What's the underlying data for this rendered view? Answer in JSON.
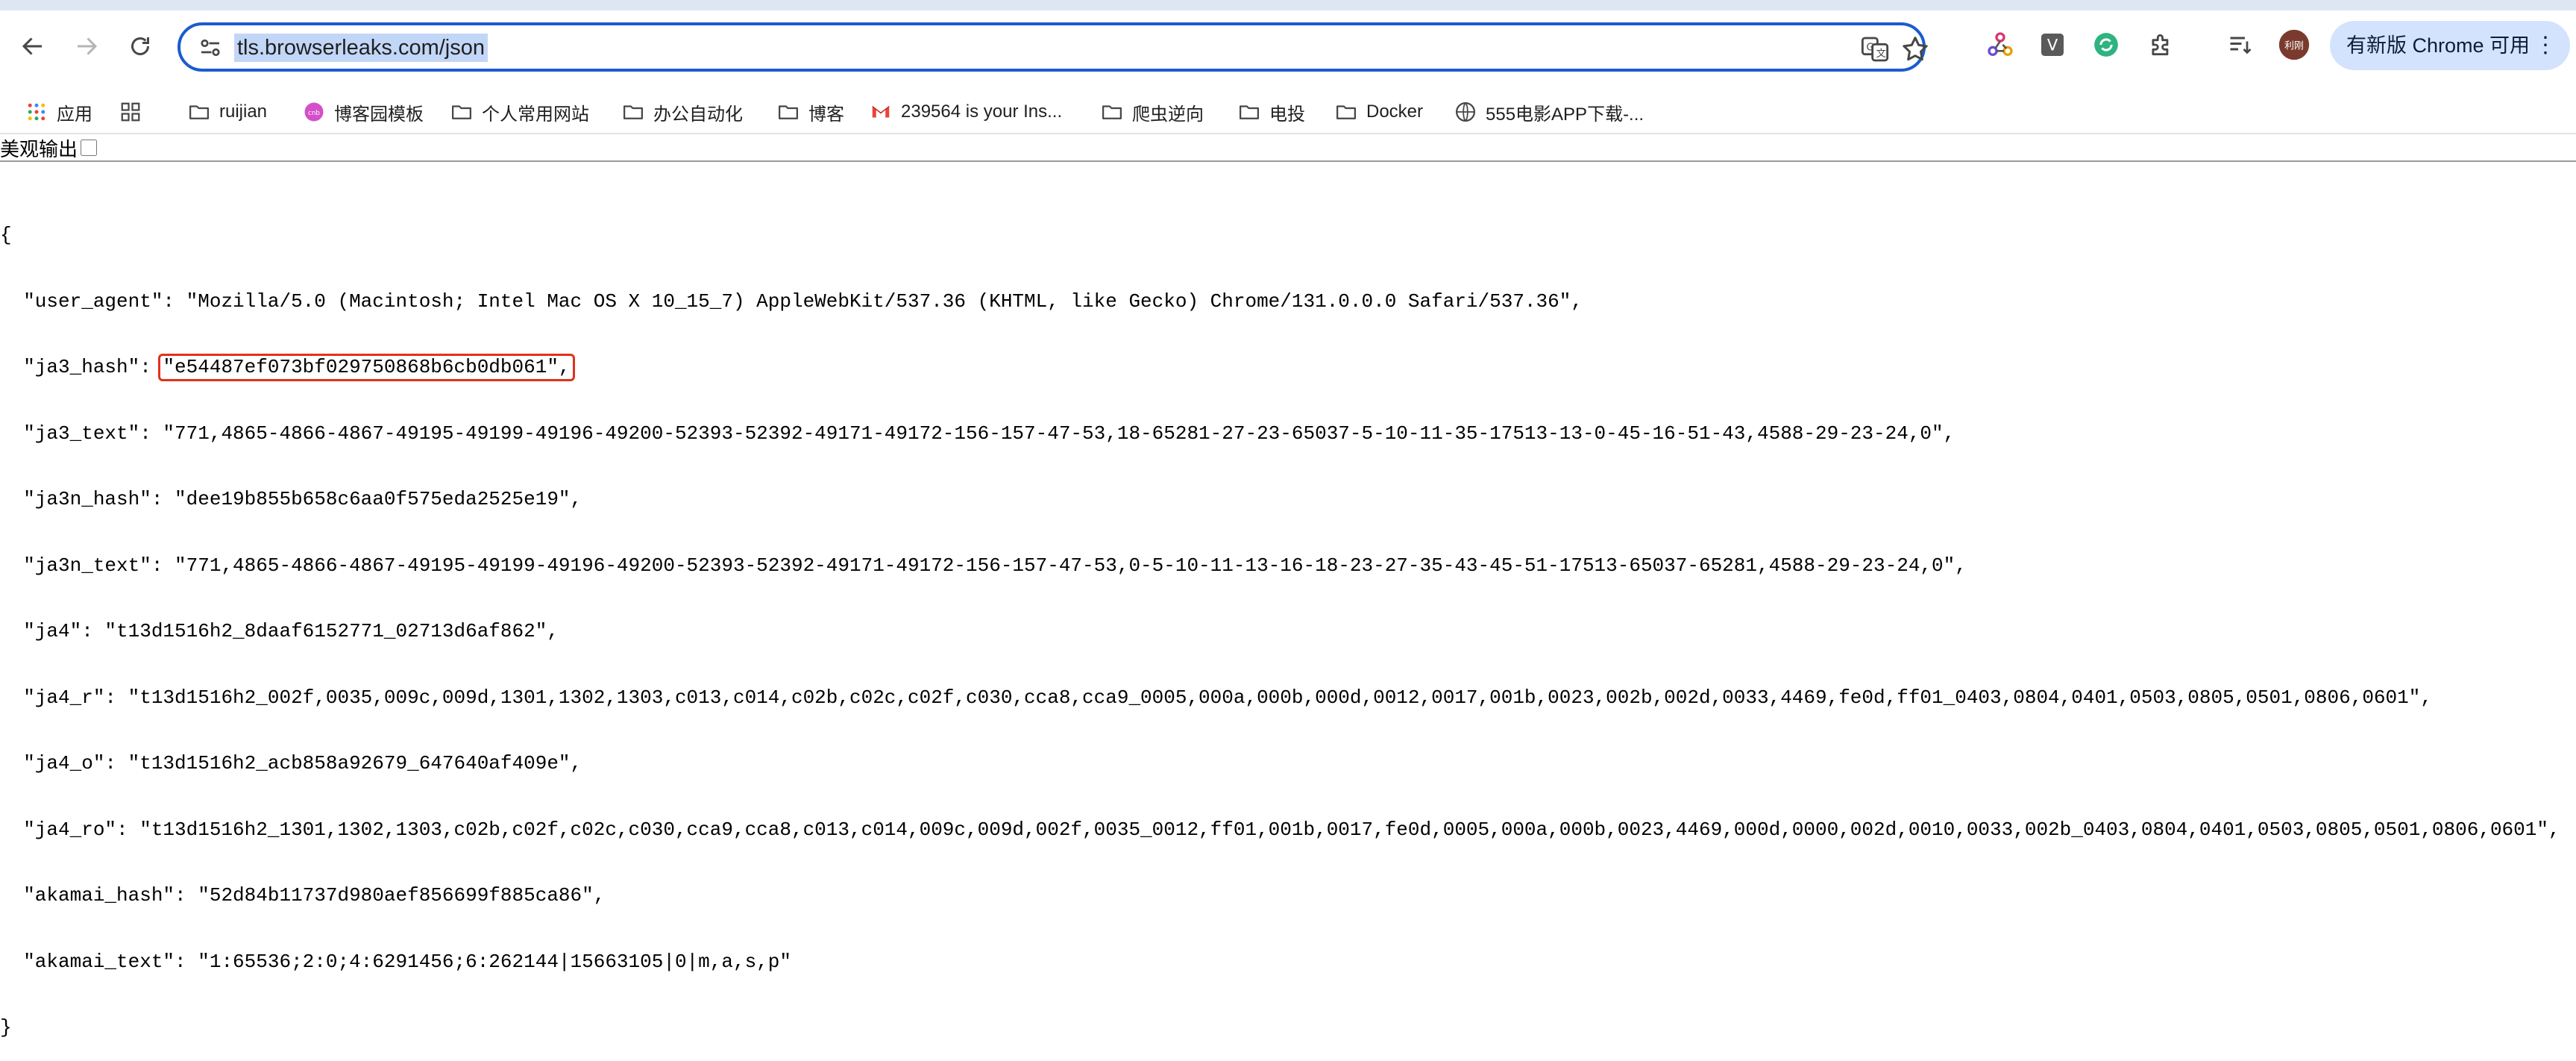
{
  "browser": {
    "url": "tls.browserleaks.com/json",
    "update_button": "有新版 Chrome 可用",
    "profile_initials": "利刚"
  },
  "bookmarks": [
    {
      "label": "应用",
      "icon": "apps-grid-icon"
    },
    {
      "label": "",
      "icon": "tab-groups-icon"
    },
    {
      "label": "ruijian",
      "icon": "folder-icon"
    },
    {
      "label": "博客园模板",
      "icon": "blog-site-icon"
    },
    {
      "label": "个人常用网站",
      "icon": "folder-icon"
    },
    {
      "label": "办公自动化",
      "icon": "folder-icon"
    },
    {
      "label": "博客",
      "icon": "folder-icon"
    },
    {
      "label": "239564 is your Ins...",
      "icon": "gmail-icon"
    },
    {
      "label": "爬虫逆向",
      "icon": "folder-icon"
    },
    {
      "label": "电投",
      "icon": "folder-icon"
    },
    {
      "label": "Docker",
      "icon": "folder-icon"
    },
    {
      "label": "555电影APP下载-...",
      "icon": "globe-icon"
    }
  ],
  "page": {
    "pretty_label": "美观输出",
    "lines": [
      "{",
      "  \"user_agent\": \"Mozilla/5.0 (Macintosh; Intel Mac OS X 10_15_7) AppleWebKit/537.36 (KHTML, like Gecko) Chrome/131.0.0.0 Safari/537.36\",",
      "  \"ja3_hash\": \"e54487ef073bf029750868b6cb0db061\",",
      "  \"ja3_text\": \"771,4865-4866-4867-49195-49199-49196-49200-52393-52392-49171-49172-156-157-47-53,18-65281-27-23-65037-5-10-11-35-17513-13-0-45-16-51-43,4588-29-23-24,0\",",
      "  \"ja3n_hash\": \"dee19b855b658c6aa0f575eda2525e19\",",
      "  \"ja3n_text\": \"771,4865-4866-4867-49195-49199-49196-49200-52393-52392-49171-49172-156-157-47-53,0-5-10-11-13-16-18-23-27-35-43-45-51-17513-65037-65281,4588-29-23-24,0\",",
      "  \"ja4\": \"t13d1516h2_8daaf6152771_02713d6af862\",",
      "  \"ja4_r\": \"t13d1516h2_002f,0035,009c,009d,1301,1302,1303,c013,c014,c02b,c02c,c02f,c030,cca8,cca9_0005,000a,000b,000d,0012,0017,001b,0023,002b,002d,0033,4469,fe0d,ff01_0403,0804,0401,0503,0805,0501,0806,0601\",",
      "  \"ja4_o\": \"t13d1516h2_acb858a92679_647640af409e\",",
      "  \"ja4_ro\": \"t13d1516h2_1301,1302,1303,c02b,c02f,c02c,c030,cca9,cca8,c013,c014,009c,009d,002f,0035_0012,ff01,001b,0017,fe0d,0005,000a,000b,0023,4469,000d,0000,002d,0010,0033,002b_0403,0804,0401,0503,0805,0501,0806,0601\",",
      "  \"akamai_hash\": \"52d84b11737d980aef856699f885ca86\",",
      "  \"akamai_text\": \"1:65536;2:0;4:6291456;6:262144|15663105|0|m,a,s,p\"",
      "}"
    ],
    "ja3_hash_prefix": "  \"ja3_hash\": ",
    "ja3_hash_highlight": "\"e54487ef073bf029750868b6cb0db061\",",
    "highlight_color": "#e0321c"
  }
}
